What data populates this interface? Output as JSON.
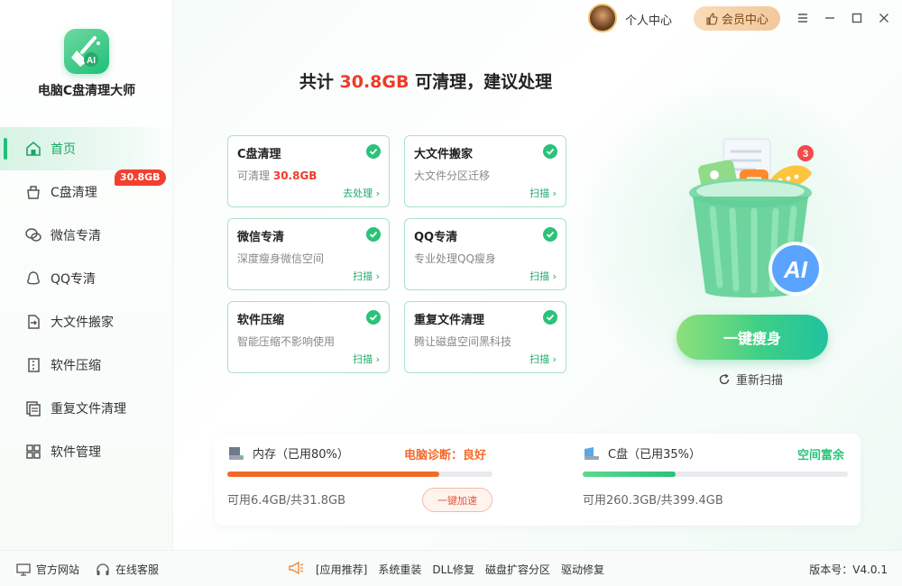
{
  "app": {
    "name": "电脑C盘清理大师"
  },
  "titlebar": {
    "profile": "个人中心",
    "vip": "会员中心"
  },
  "sidebar": {
    "items": [
      {
        "label": "首页",
        "icon": "home-icon"
      },
      {
        "label": "C盘清理",
        "icon": "broom-icon",
        "badge": "30.8GB"
      },
      {
        "label": "微信专清",
        "icon": "wechat-icon"
      },
      {
        "label": "QQ专清",
        "icon": "qq-icon"
      },
      {
        "label": "大文件搬家",
        "icon": "move-file-icon"
      },
      {
        "label": "软件压缩",
        "icon": "compress-icon"
      },
      {
        "label": "重复文件清理",
        "icon": "duplicate-file-icon"
      },
      {
        "label": "软件管理",
        "icon": "apps-grid-icon"
      }
    ]
  },
  "headline": {
    "prefix": "共计",
    "size": "30.8GB",
    "suffix": "可清理，建议处理"
  },
  "cards": [
    {
      "title": "C盘清理",
      "desc": "可清理",
      "value": "30.8GB",
      "action": "去处理 ›"
    },
    {
      "title": "大文件搬家",
      "desc": "大文件分区迁移",
      "action": "扫描 ›"
    },
    {
      "title": "微信专清",
      "desc": "深度瘦身微信空间",
      "action": "扫描 ›"
    },
    {
      "title": "QQ专清",
      "desc": "专业处理QQ瘦身",
      "action": "扫描 ›"
    },
    {
      "title": "软件压缩",
      "desc": "智能压缩不影响使用",
      "action": "扫描 ›"
    },
    {
      "title": "重复文件清理",
      "desc": "腾让磁盘空间黑科技",
      "action": "扫描 ›"
    }
  ],
  "illustration": {
    "notification_count": "3",
    "ai_label": "AI"
  },
  "actions": {
    "slim": "一键瘦身",
    "rescan": "重新扫描"
  },
  "memory": {
    "label": "内存（已用80%）",
    "used_fraction": 0.8,
    "status": "电脑诊断：良好",
    "avail": "可用6.4GB/共31.8GB",
    "speed_btn": "一键加速",
    "color": "#f26a2a"
  },
  "disk": {
    "label": "C盘（已用35%）",
    "used_fraction": 0.35,
    "status": "空间富余",
    "avail": "可用260.3GB/共399.4GB",
    "color": "#2bc27a"
  },
  "footer": {
    "website": "官方网站",
    "service": "在线客服",
    "recs": [
      "[应用推荐]",
      "系统重装",
      "DLL修复",
      "磁盘扩容分区",
      "驱动修复"
    ],
    "version": "版本号：V4.0.1"
  },
  "colors": {
    "accent": "#20c07a",
    "alert": "#f03a2a"
  }
}
